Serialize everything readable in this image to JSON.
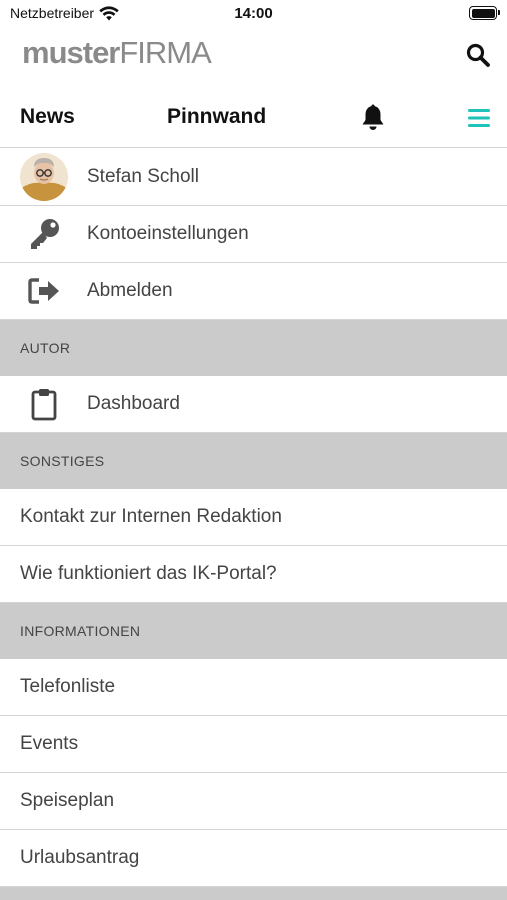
{
  "status_bar": {
    "carrier": "Netzbetreiber",
    "time": "14:00",
    "wifi_icon": "wifi-icon",
    "battery_icon": "battery-icon"
  },
  "header": {
    "logo_lead": "muster",
    "logo_brand": "FIRMA",
    "search_icon": "search-icon"
  },
  "tabs": {
    "news": "News",
    "pinnwand": "Pinnwand",
    "bell_icon": "bell-icon",
    "menu_icon": "hamburger-menu-icon",
    "accent": "#1fc2b8"
  },
  "menu": {
    "user": {
      "name": "Stefan Scholl",
      "icon": "avatar"
    },
    "account": {
      "label": "Kontoeinstellungen",
      "icon": "key-icon"
    },
    "logout": {
      "label": "Abmelden",
      "icon": "sign-out-icon"
    },
    "section_author": "AUTOR",
    "dashboard": {
      "label": "Dashboard",
      "icon": "clipboard-icon"
    },
    "section_misc": "SONSTIGES",
    "contact": "Kontakt zur Internen Redaktion",
    "howto": "Wie funktioniert das IK-Portal?",
    "section_info": "INFORMATIONEN",
    "phonebook": "Telefonliste",
    "events": "Events",
    "menu_plan": "Speiseplan",
    "vacation": "Urlaubsantrag"
  },
  "colors": {
    "section_bg": "#cbcbcb",
    "divider": "#d4d4d4",
    "logo_gray": "#8a8a8a"
  }
}
